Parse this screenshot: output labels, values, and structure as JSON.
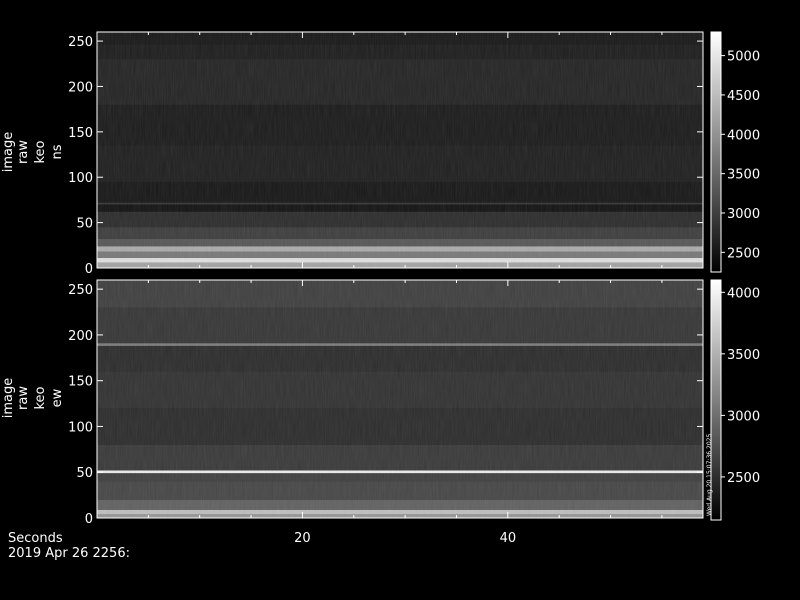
{
  "chart_data": [
    {
      "type": "heatmap",
      "ylabel": [
        "image",
        "raw",
        "keo",
        "ns"
      ],
      "ylim": [
        0,
        260
      ],
      "yticks": [
        0,
        50,
        100,
        150,
        200,
        250
      ],
      "xlim": [
        0,
        59
      ],
      "xticks": [
        20,
        40
      ],
      "colorbar": {
        "range": [
          2250,
          5300
        ],
        "ticks": [
          2500,
          3000,
          3500,
          4000,
          4500,
          5000
        ]
      },
      "bands": [
        {
          "y": [
            0,
            6
          ],
          "value": 4200
        },
        {
          "y": [
            6,
            11
          ],
          "value": 4900
        },
        {
          "y": [
            11,
            18
          ],
          "value": 3700
        },
        {
          "y": [
            18,
            24
          ],
          "value": 4300
        },
        {
          "y": [
            24,
            32
          ],
          "value": 3300
        },
        {
          "y": [
            32,
            45
          ],
          "value": 3000
        },
        {
          "y": [
            45,
            62
          ],
          "value": 2800
        },
        {
          "y": [
            62,
            70
          ],
          "value": 2500
        },
        {
          "y": [
            70,
            72
          ],
          "value": 2900
        },
        {
          "y": [
            72,
            95
          ],
          "value": 2550
        },
        {
          "y": [
            95,
            135
          ],
          "value": 2650
        },
        {
          "y": [
            135,
            180
          ],
          "value": 2600
        },
        {
          "y": [
            180,
            230
          ],
          "value": 2700
        },
        {
          "y": [
            230,
            246
          ],
          "value": 2620
        },
        {
          "y": [
            246,
            260
          ],
          "value": 2560
        }
      ]
    },
    {
      "type": "heatmap",
      "ylabel": [
        "image",
        "raw",
        "keo",
        "ew"
      ],
      "ylim": [
        0,
        260
      ],
      "yticks": [
        0,
        50,
        100,
        150,
        200,
        250
      ],
      "xlim": [
        0,
        59
      ],
      "xticks": [
        20,
        40
      ],
      "colorbar": {
        "range": [
          2150,
          4100
        ],
        "ticks": [
          2500,
          3000,
          3500,
          4000
        ]
      },
      "side_text": "Wed Aug 20 15:07:36 2025",
      "bands": [
        {
          "y": [
            0,
            4
          ],
          "value": 3300
        },
        {
          "y": [
            4,
            9
          ],
          "value": 3600
        },
        {
          "y": [
            9,
            20
          ],
          "value": 2900
        },
        {
          "y": [
            20,
            40
          ],
          "value": 2700
        },
        {
          "y": [
            40,
            49
          ],
          "value": 2650
        },
        {
          "y": [
            49,
            52
          ],
          "value": 3950
        },
        {
          "y": [
            52,
            80
          ],
          "value": 2600
        },
        {
          "y": [
            80,
            120
          ],
          "value": 2500
        },
        {
          "y": [
            120,
            160
          ],
          "value": 2550
        },
        {
          "y": [
            160,
            188
          ],
          "value": 2500
        },
        {
          "y": [
            188,
            191
          ],
          "value": 3100
        },
        {
          "y": [
            191,
            230
          ],
          "value": 2580
        },
        {
          "y": [
            230,
            260
          ],
          "value": 2650
        }
      ]
    }
  ],
  "footer": {
    "xlabel": "Seconds",
    "date": "2019 Apr 26 2256:"
  }
}
